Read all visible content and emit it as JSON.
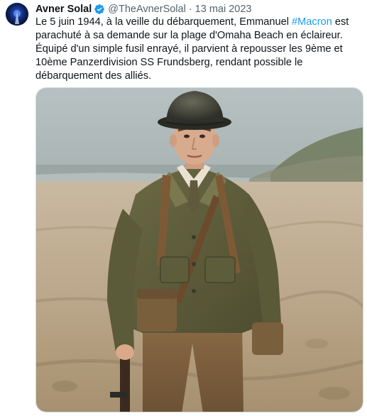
{
  "tweet": {
    "author_name": "Avner Solal",
    "verified": true,
    "handle": "@TheAvnerSolal",
    "separator": "·",
    "date": "13 mai 2023",
    "text_before_hashtag": "Le 5 juin 1944, à la veille du débarquement, Emmanuel ",
    "hashtag": "#Macron",
    "text_after_hashtag": " est parachuté à sa demande sur la plage d'Omaha Beach en éclaireur. Équipé d'un simple fusil enrayé, il parvient à repousser les 9ème et 10ème Panzerdivision SS Frundsberg, rendant possible le débarquement des alliés."
  },
  "icons": {
    "verified": "verified-badge-icon",
    "avatar": "profile-avatar"
  },
  "colors": {
    "link": "#1d9bf0",
    "secondary_text": "#536471",
    "verified_badge": "#1d9bf0"
  }
}
